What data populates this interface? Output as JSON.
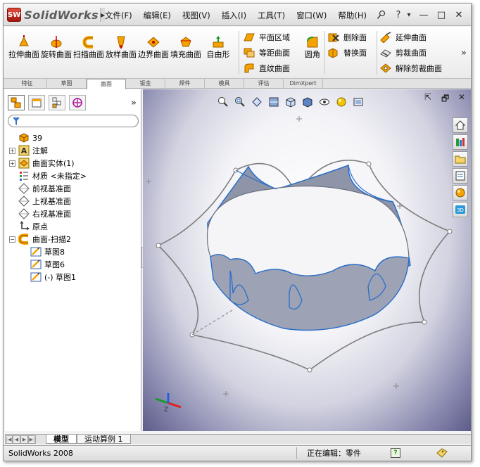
{
  "app": {
    "logo_badge": "SW",
    "logo_text": "SolidWorks",
    "logo_arrow": "▶"
  },
  "menu": [
    "文件(F)",
    "编辑(E)",
    "视图(V)",
    "插入(I)",
    "工具(T)",
    "窗口(W)",
    "帮助(H)"
  ],
  "menu_tools": {
    "pin_icon": "pin-icon",
    "help": "?",
    "dropdown": "▾"
  },
  "window_controls": {
    "minimize": "—",
    "restore": "□",
    "close": "✕"
  },
  "command_manager": {
    "big_tools": [
      {
        "label": "拉伸曲面",
        "icon": "extruded-surface-icon"
      },
      {
        "label": "旋转曲面",
        "icon": "revolved-surface-icon"
      },
      {
        "label": "扫描曲面",
        "icon": "swept-surface-icon"
      },
      {
        "label": "放样曲面",
        "icon": "lofted-surface-icon"
      },
      {
        "label": "边界曲面",
        "icon": "boundary-surface-icon"
      },
      {
        "label": "填充曲面",
        "icon": "filled-surface-icon"
      },
      {
        "label": "自由形",
        "icon": "freeform-icon"
      }
    ],
    "col1": [
      {
        "label": "平面区域",
        "icon": "planar-surface-icon"
      },
      {
        "label": "等距曲面",
        "icon": "offset-surface-icon"
      },
      {
        "label": "直纹曲面",
        "icon": "ruled-surface-icon"
      }
    ],
    "fillet": {
      "label": "圆角",
      "icon": "fillet-icon"
    },
    "col2": [
      {
        "label": "删除面",
        "icon": "delete-face-icon"
      },
      {
        "label": "替换面",
        "icon": "replace-face-icon"
      }
    ],
    "col3": [
      {
        "label": "延伸曲面",
        "icon": "extend-surface-icon"
      },
      {
        "label": "剪裁曲面",
        "icon": "trim-surface-icon"
      },
      {
        "label": "解除剪裁曲面",
        "icon": "untrim-surface-icon"
      }
    ],
    "more": "»"
  },
  "tabs": [
    {
      "label": "特征",
      "active": false
    },
    {
      "label": "草图",
      "active": false
    },
    {
      "label": "曲面",
      "active": true
    },
    {
      "label": "钣金",
      "active": false
    },
    {
      "label": "焊件",
      "active": false
    },
    {
      "label": "模具",
      "active": false
    },
    {
      "label": "评估",
      "active": false
    },
    {
      "label": "DimXpert",
      "active": false
    }
  ],
  "panel": {
    "more": "»",
    "tree": [
      {
        "label": "39",
        "indent": 0,
        "expander": "",
        "icon": "part-icon"
      },
      {
        "label": "注解",
        "indent": 0,
        "expander": "+",
        "icon": "annotations-icon"
      },
      {
        "label": "曲面实体(1)",
        "indent": 0,
        "expander": "+",
        "icon": "surface-bodies-icon"
      },
      {
        "label": "材质 <未指定>",
        "indent": 0,
        "expander": " ",
        "icon": "material-icon"
      },
      {
        "label": "前视基准面",
        "indent": 0,
        "expander": " ",
        "icon": "plane-icon"
      },
      {
        "label": "上视基准面",
        "indent": 0,
        "expander": " ",
        "icon": "plane-icon"
      },
      {
        "label": "右视基准面",
        "indent": 0,
        "expander": " ",
        "icon": "plane-icon"
      },
      {
        "label": "原点",
        "indent": 0,
        "expander": " ",
        "icon": "origin-icon"
      },
      {
        "label": "曲面-扫描2",
        "indent": 0,
        "expander": "−",
        "icon": "sweep-feature-icon"
      },
      {
        "label": "草图8",
        "indent": 1,
        "expander": " ",
        "icon": "sketch-icon"
      },
      {
        "label": "草图6",
        "indent": 1,
        "expander": " ",
        "icon": "sketch-icon"
      },
      {
        "label": "(-) 草图1",
        "indent": 1,
        "expander": " ",
        "icon": "sketch-icon"
      }
    ]
  },
  "viewport": {
    "close": "✕",
    "restore": "🗗",
    "min": "⇱"
  },
  "bottom_tabs": [
    "模型",
    "运动算例 1"
  ],
  "status": {
    "left": "SolidWorks 2008",
    "mode": "正在编辑：零件",
    "help": "?"
  },
  "colors": {
    "surface_edge": "#2a6fc9",
    "surface_fill": "#8f95a8",
    "sketch_line": "#7a7a7a",
    "accent_orange": "#f4a300"
  }
}
